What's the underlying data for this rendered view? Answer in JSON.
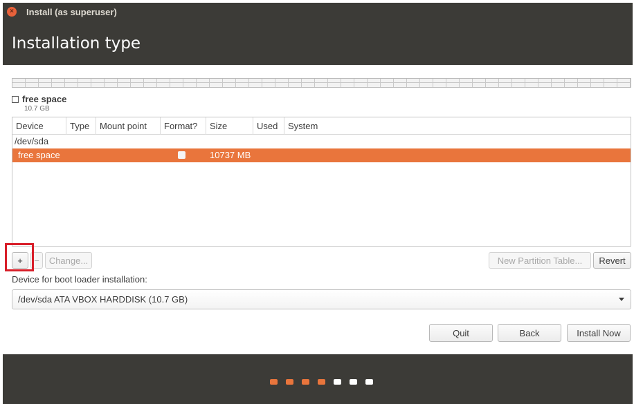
{
  "window": {
    "title": "Install (as superuser)"
  },
  "page": {
    "title": "Installation type"
  },
  "legend": {
    "name": "free space",
    "size": "10.7 GB"
  },
  "table": {
    "columns": [
      "Device",
      "Type",
      "Mount point",
      "Format?",
      "Size",
      "Used",
      "System"
    ],
    "device_row": {
      "device": "/dev/sda"
    },
    "selected_row": {
      "device": "free space",
      "type": "",
      "mount": "",
      "format_checked": false,
      "size": "10737 MB",
      "used": "",
      "system": ""
    }
  },
  "toolbar": {
    "add_label": "+",
    "remove_label": "−",
    "change_label": "Change...",
    "new_table_label": "New Partition Table...",
    "revert_label": "Revert"
  },
  "boot": {
    "label": "Device for boot loader installation:",
    "selected": "/dev/sda ATA VBOX HARDDISK (10.7 GB)"
  },
  "actions": {
    "quit": "Quit",
    "back": "Back",
    "install": "Install Now"
  },
  "progress": {
    "total_steps": 7,
    "completed_steps": 4,
    "done_color": "#e9753c",
    "pending_color": "#ffffff"
  },
  "colors": {
    "accent": "#e9753c",
    "header_bg": "#3c3b37",
    "highlight": "#d81e29"
  }
}
